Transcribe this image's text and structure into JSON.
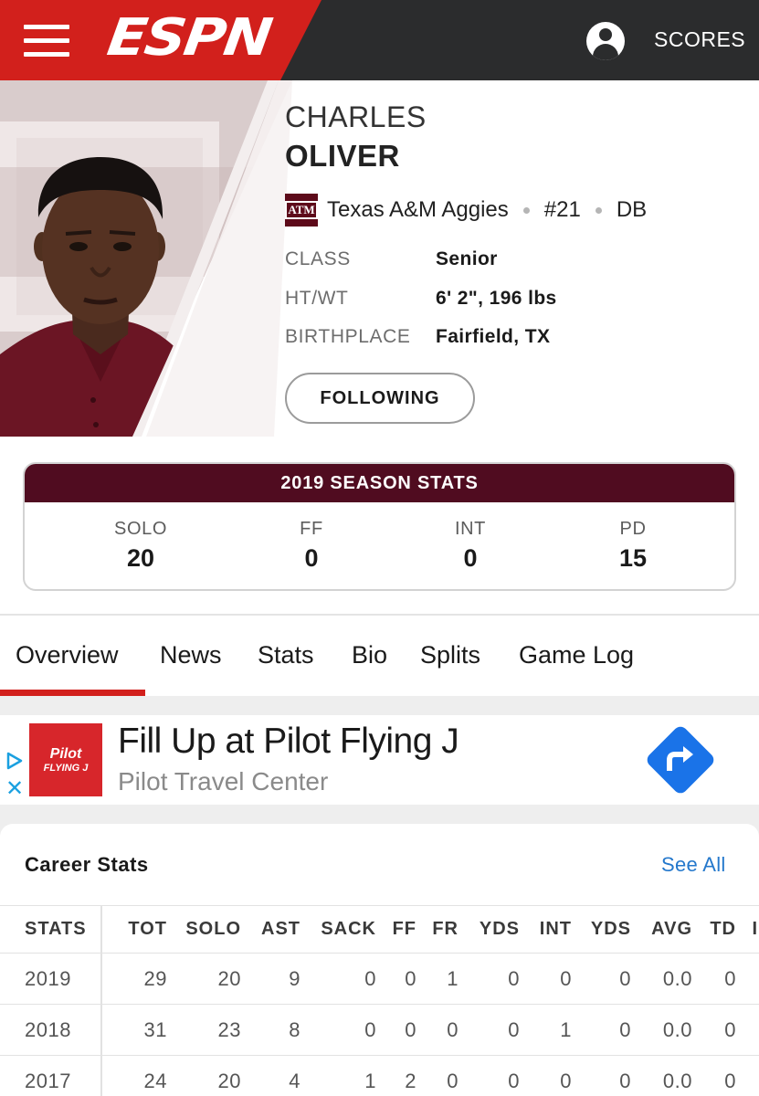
{
  "nav": {
    "logo_text": "ESPN",
    "scores_label": "SCORES"
  },
  "player": {
    "first_name": "CHARLES",
    "last_name": "OLIVER",
    "team_logo_text": "ATM",
    "team": "Texas A&M Aggies",
    "number": "#21",
    "position": "DB",
    "bio": [
      {
        "label": "CLASS",
        "value": "Senior"
      },
      {
        "label": "HT/WT",
        "value": "6' 2\", 196 lbs"
      },
      {
        "label": "BIRTHPLACE",
        "value": "Fairfield, TX"
      }
    ],
    "follow_label": "FOLLOWING"
  },
  "season_stats": {
    "title": "2019 SEASON STATS",
    "items": [
      {
        "label": "SOLO",
        "value": "20"
      },
      {
        "label": "FF",
        "value": "0"
      },
      {
        "label": "INT",
        "value": "0"
      },
      {
        "label": "PD",
        "value": "15"
      }
    ]
  },
  "tabs": [
    "Overview",
    "News",
    "Stats",
    "Bio",
    "Splits",
    "Game Log"
  ],
  "active_tab": "Overview",
  "ad": {
    "logo_line1": "Pilot",
    "logo_line2": "FLYING J",
    "title": "Fill Up at Pilot Flying J",
    "subtitle": "Pilot Travel Center",
    "close_glyph": "✕"
  },
  "career": {
    "title": "Career Stats",
    "see_all": "See All",
    "columns": [
      "STATS",
      "TOT",
      "SOLO",
      "AST",
      "SACK",
      "FF",
      "FR",
      "YDS",
      "INT",
      "YDS",
      "AVG",
      "TD",
      "I"
    ],
    "rows": [
      [
        "2019",
        "29",
        "20",
        "9",
        "0",
        "0",
        "1",
        "0",
        "0",
        "0",
        "0.0",
        "0"
      ],
      [
        "2018",
        "31",
        "23",
        "8",
        "0",
        "0",
        "0",
        "0",
        "1",
        "0",
        "0.0",
        "0"
      ],
      [
        "2017",
        "24",
        "20",
        "4",
        "1",
        "2",
        "0",
        "0",
        "0",
        "0",
        "0.0",
        "0"
      ]
    ]
  },
  "colors": {
    "espn_red": "#d2201c",
    "nav_dark": "#2b2c2d",
    "aggie_maroon": "#500c20",
    "link_blue": "#2478cc",
    "ad_red": "#d7262b",
    "ad_arrow_blue": "#1a73e8"
  }
}
